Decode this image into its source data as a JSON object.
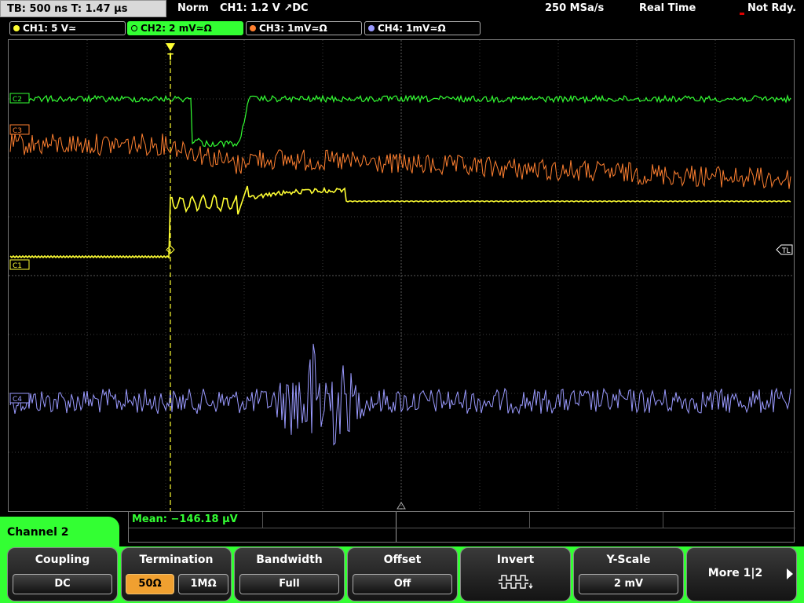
{
  "topbar": {
    "timebase": "TB: 500 ns   T: 1.47 µs",
    "mode": "Norm",
    "trigger": "CH1: 1.2 V ↗DC",
    "sample_rate": "250 MSa/s",
    "acq_mode": "Real Time",
    "status": "Not Rdy."
  },
  "channels": [
    {
      "label": "CH1: 5 V≃",
      "color": "#ffff33"
    },
    {
      "label": "CH2: 2 mV≃Ω",
      "color": "#33ff33"
    },
    {
      "label": "CH3: 1mV≃Ω",
      "color": "#ff8030"
    },
    {
      "label": "CH4: 1mV≃Ω",
      "color": "#9a9aff"
    }
  ],
  "markers": {
    "c1": "C1",
    "c2": "C2",
    "c3": "C3",
    "c4": "C4",
    "tl": "TL",
    "trigger_point": "T"
  },
  "measurement": {
    "text": "Mean: −146.18 µV"
  },
  "menu": {
    "channel_label": "Channel 2",
    "coupling": {
      "title": "Coupling",
      "value": "DC"
    },
    "termination": {
      "title": "Termination",
      "opt1": "50Ω",
      "opt2": "1MΩ",
      "selected": "50Ω"
    },
    "bandwidth": {
      "title": "Bandwidth",
      "value": "Full"
    },
    "offset": {
      "title": "Offset",
      "value": "Off"
    },
    "invert": {
      "title": "Invert",
      "icon": "invert-waveform-icon"
    },
    "yscale": {
      "title": "Y-Scale",
      "value": "2 mV"
    },
    "more": {
      "label": "More 1|2",
      "icon": "arrow-right-icon"
    }
  },
  "colors": {
    "ch1": "#ffff33",
    "ch2": "#33ff33",
    "ch3": "#ff8030",
    "ch4": "#9a9aff",
    "menu_accent": "#33ff33",
    "selected_option": "#f0a030"
  }
}
